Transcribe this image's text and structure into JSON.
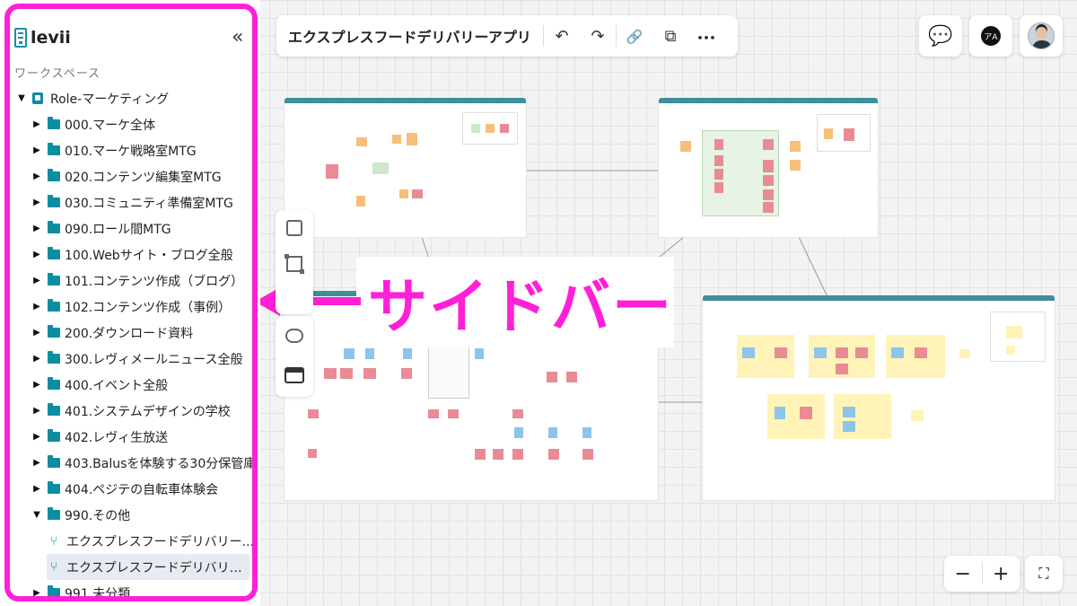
{
  "app": {
    "name": "levii",
    "collapse_icon": "«"
  },
  "sidebar": {
    "section_label": "ワークスペース",
    "root": {
      "label": "Role-マーケティング",
      "icon": "role-icon"
    },
    "folders": [
      "000.マーケ全体",
      "010.マーケ戦略室MTG",
      "020.コンテンツ編集室MTG",
      "030.コミュニティ準備室MTG",
      "090.ロール間MTG",
      "100.Webサイト・ブログ全般",
      "101.コンテンツ作成（ブログ）",
      "102.コンテンツ作成（事例）",
      "200.ダウンロード資料",
      "300.レヴィメールニュース全般",
      "400.イベント全般",
      "401.システムデザインの学校",
      "402.レヴィ生放送",
      "403.Balusを体験する30分保管庫",
      "404.ペジテの自転車体験会"
    ],
    "open_folder": "990.その他",
    "open_folder_items": [
      "エクスプレスフードデリバリー...",
      "エクスプレスフードデリバリー..."
    ],
    "last_folder": "991.未分類"
  },
  "toolbar": {
    "title": "エクスプレスフードデリバリーアプリ",
    "undo_icon": "↶",
    "redo_icon": "↷",
    "link_icon": "🔗",
    "copy_icon": "⧉",
    "more_icon": "•••"
  },
  "top_right": {
    "ai_label": "アA"
  },
  "annotation": {
    "text": "サイドバー"
  },
  "zoom": {
    "minus": "−",
    "plus": "+",
    "fit": "⛶"
  },
  "colors": {
    "highlight": "#ff1fd8",
    "accent": "#0f8da0",
    "board_header": "#3f8e9a"
  }
}
